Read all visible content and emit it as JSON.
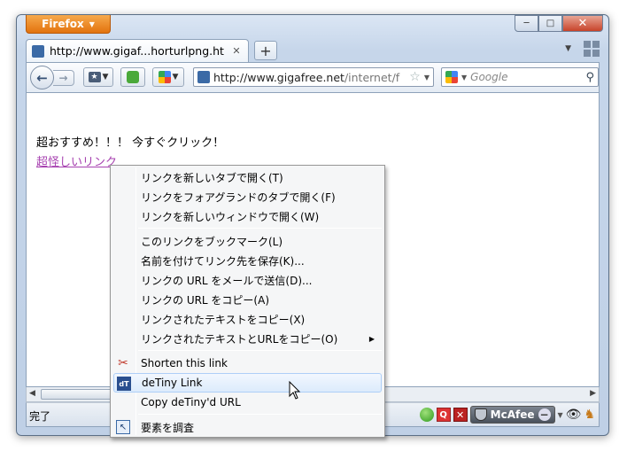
{
  "window": {
    "app_button": "Firefox",
    "caption": {
      "minimize": "─",
      "maximize": "□",
      "close": "✕"
    }
  },
  "tabs": [
    {
      "title": "http://www.gigaf...horturlpng.html",
      "close": "✕"
    }
  ],
  "new_tab": "+",
  "navbar": {
    "back": "←",
    "forward": "→",
    "url_domain": "http://www.gigafree.net",
    "url_path": "/internet/f",
    "search_placeholder": "Google",
    "search_icon": "magnifier-icon"
  },
  "page": {
    "text": "超おすすめ！！！ 今すぐクリック！",
    "link": "超怪しいリンク"
  },
  "status": {
    "text": "完了",
    "mcafee": "McAfee"
  },
  "context_menu": {
    "items": [
      {
        "label": "リンクを新しいタブで開く(T)"
      },
      {
        "label": "リンクをフォアグランドのタブで開く(F)"
      },
      {
        "label": "リンクを新しいウィンドウで開く(W)"
      },
      {
        "label": "このリンクをブックマーク(L)"
      },
      {
        "label": "名前を付けてリンク先を保存(K)..."
      },
      {
        "label": "リンクの URL をメールで送信(D)..."
      },
      {
        "label": "リンクの URL をコピー(A)"
      },
      {
        "label": "リンクされたテキストをコピー(X)"
      },
      {
        "label": "リンクされたテキストとURLをコピー(O)",
        "submenu": "▶"
      },
      {
        "label": "Shorten this link",
        "icon": "scissors-icon"
      },
      {
        "label": "deTiny Link",
        "icon": "detiny-icon",
        "highlighted": true
      },
      {
        "label": "Copy deTiny'd URL"
      },
      {
        "label": "要素を調査",
        "icon": "inspect-icon"
      }
    ]
  }
}
